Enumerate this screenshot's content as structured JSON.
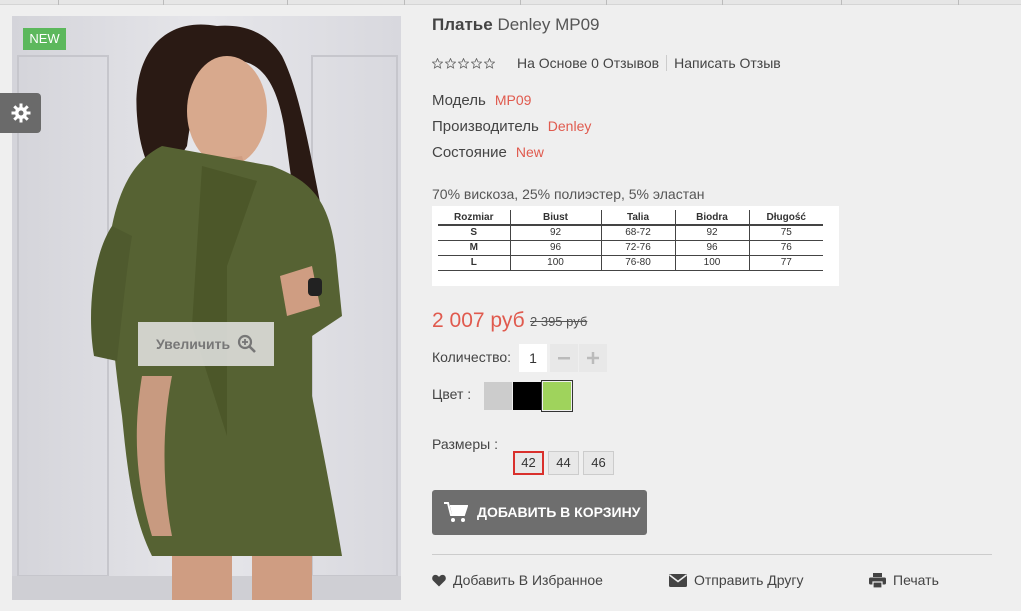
{
  "product": {
    "title_bold": "Платье",
    "title_rest": "Denley MP09",
    "badge": "NEW",
    "zoom_label": "Увеличить",
    "image_alt": "Платье Denley MP09"
  },
  "reviews": {
    "rating": 0,
    "max_rating": 5,
    "summary": "На Основе 0 Отзывов",
    "write_link": "Написать Отзыв"
  },
  "specs": [
    {
      "label": "Модель",
      "value": "MP09"
    },
    {
      "label": "Производитель",
      "value": "Denley"
    },
    {
      "label": "Состояние",
      "value": "New"
    }
  ],
  "description": "70% вискоза, 25% полиэстер, 5% эластан",
  "size_chart": {
    "headers": [
      "Rozmiar",
      "Biust",
      "Talia",
      "Biodra",
      "Długość"
    ],
    "rows": [
      [
        "S",
        "92",
        "68-72",
        "92",
        "75"
      ],
      [
        "M",
        "96",
        "72-76",
        "96",
        "76"
      ],
      [
        "L",
        "100",
        "76-80",
        "100",
        "77"
      ]
    ]
  },
  "price": {
    "current": "2 007 руб",
    "old": "2 395 руб"
  },
  "quantity": {
    "label": "Количество:",
    "value": "1"
  },
  "colors": {
    "label": "Цвет :",
    "swatches": [
      "#cccccc",
      "#000000",
      "#9fd35c"
    ],
    "selected_index": 2
  },
  "sizes": {
    "label": "Размеры :",
    "options": [
      "42",
      "44",
      "46"
    ],
    "selected": "42"
  },
  "cart_button": "ДОБАВИТЬ В КОРЗИНУ",
  "actions": {
    "wishlist": "Добавить В Избранное",
    "send_friend": "Отправить Другу",
    "print": "Печать"
  },
  "theme": {
    "accent": "#e05a4e",
    "badge_green": "#5cb85c",
    "button_gray": "#6e6e6e"
  }
}
